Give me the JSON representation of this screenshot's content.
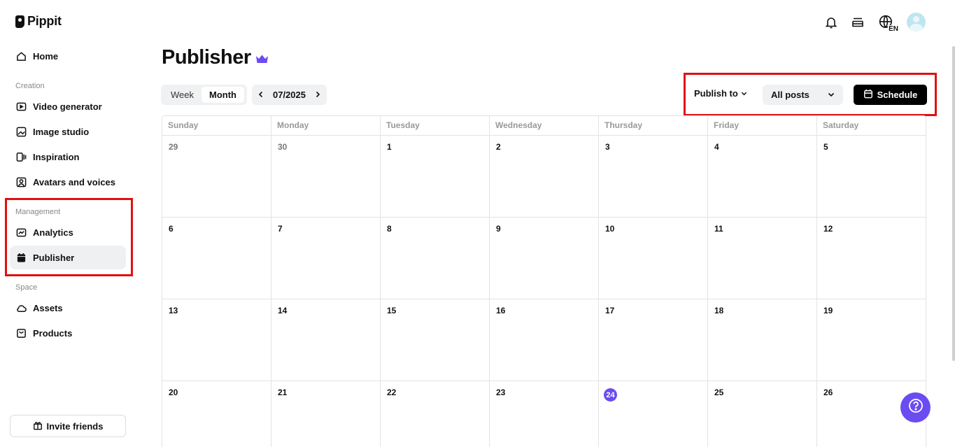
{
  "app": {
    "name": "Pippit"
  },
  "sidebar": {
    "home": "Home",
    "sections": {
      "creation": "Creation",
      "management": "Management",
      "space": "Space"
    },
    "creation_items": [
      "Video generator",
      "Image studio",
      "Inspiration",
      "Avatars and voices"
    ],
    "management_items": [
      "Analytics",
      "Publisher"
    ],
    "space_items": [
      "Assets",
      "Products"
    ],
    "invite": "Invite friends"
  },
  "header": {
    "language": "EN"
  },
  "page": {
    "title": "Publisher"
  },
  "toolbar": {
    "view_week": "Week",
    "view_month": "Month",
    "selected_view": "Month",
    "period": "07/2025",
    "publish_to": "Publish to",
    "filter_value": "All posts",
    "schedule": "Schedule"
  },
  "calendar": {
    "weekdays": [
      "Sunday",
      "Monday",
      "Tuesday",
      "Wednesday",
      "Thursday",
      "Friday",
      "Saturday"
    ],
    "weeks": [
      [
        "29",
        "30",
        "1",
        "2",
        "3",
        "4",
        "5"
      ],
      [
        "6",
        "7",
        "8",
        "9",
        "10",
        "11",
        "12"
      ],
      [
        "13",
        "14",
        "15",
        "16",
        "17",
        "18",
        "19"
      ],
      [
        "20",
        "21",
        "22",
        "23",
        "24",
        "25",
        "26"
      ]
    ],
    "today": "24"
  },
  "colors": {
    "accent": "#6b4cf0",
    "highlight": "#e01010"
  }
}
